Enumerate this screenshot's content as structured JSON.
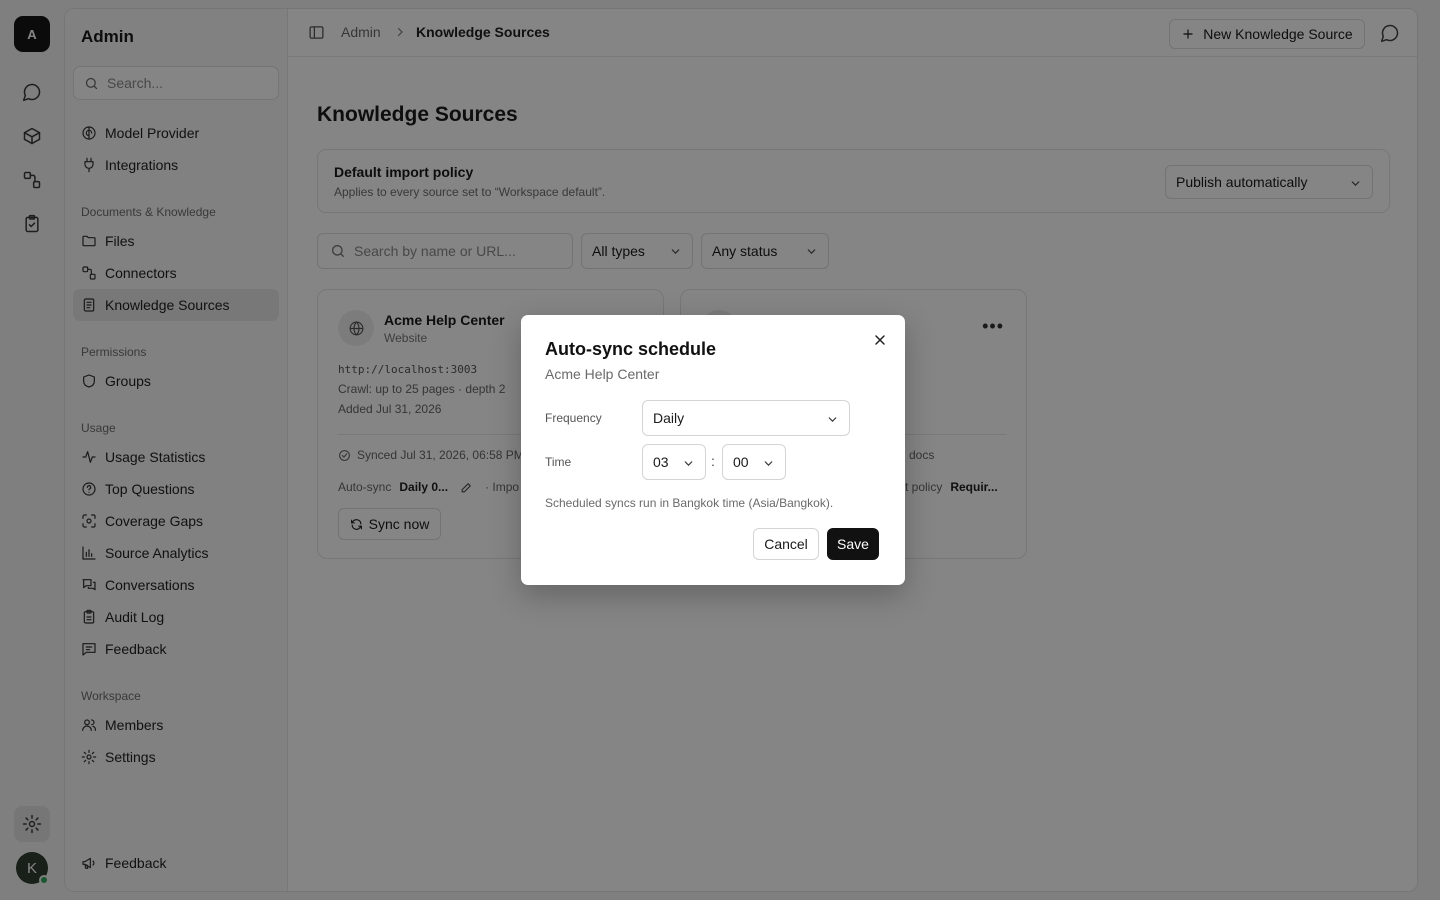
{
  "rail": {
    "logo": "A",
    "avatar": "K",
    "icons": [
      "chat-icon",
      "cube-icon",
      "connectors-icon",
      "clipboard-check-icon",
      "gear-icon"
    ]
  },
  "sidebar": {
    "title": "Admin",
    "search_placeholder": "Search...",
    "items_top": [
      {
        "label": "Model Provider",
        "icon": "brain-icon"
      },
      {
        "label": "Integrations",
        "icon": "plug-icon"
      }
    ],
    "section_docs": "Documents & Knowledge",
    "items_docs": [
      {
        "label": "Files",
        "icon": "folder-icon"
      },
      {
        "label": "Connectors",
        "icon": "connectors-icon"
      },
      {
        "label": "Knowledge Sources",
        "icon": "book-icon",
        "active": true
      }
    ],
    "section_permissions": "Permissions",
    "items_permissions": [
      {
        "label": "Groups",
        "icon": "shield-icon"
      }
    ],
    "section_usage": "Usage",
    "items_usage": [
      {
        "label": "Usage Statistics",
        "icon": "activity-icon"
      },
      {
        "label": "Top Questions",
        "icon": "help-circle-icon"
      },
      {
        "label": "Coverage Gaps",
        "icon": "scan-icon"
      },
      {
        "label": "Source Analytics",
        "icon": "bar-chart-icon"
      },
      {
        "label": "Conversations",
        "icon": "messages-icon"
      },
      {
        "label": "Audit Log",
        "icon": "clipboard-icon"
      },
      {
        "label": "Feedback",
        "icon": "message-square-text-icon"
      }
    ],
    "section_workspace": "Workspace",
    "items_workspace": [
      {
        "label": "Members",
        "icon": "users-icon"
      },
      {
        "label": "Settings",
        "icon": "gear-icon"
      }
    ],
    "footer_feedback": "Feedback"
  },
  "topbar": {
    "crumb_root": "Admin",
    "crumb_current": "Knowledge Sources",
    "new_button": "New Knowledge Source"
  },
  "main": {
    "title": "Knowledge Sources",
    "policy": {
      "title": "Default import policy",
      "subtitle": "Applies to every source set to “Workspace default”.",
      "value": "Publish automatically"
    },
    "filters": {
      "search_placeholder": "Search by name or URL...",
      "type": "All types",
      "status": "Any status"
    },
    "cards": [
      {
        "name": "Acme Help Center",
        "type": "Website",
        "url": "http://localhost:3003",
        "crawl": "Crawl: up to 25 pages · depth 2",
        "added": "Added Jul 31, 2026",
        "synced": "Synced Jul 31, 2026, 06:58 PM",
        "autosync_label": "Auto-sync",
        "autosync_value": "Daily 0...",
        "import_fragment": "· Impo",
        "sync_button": "Sync now"
      },
      {
        "synced_fragment": "docs",
        "policy_fragment": "rt policy",
        "policy_value": "Requir..."
      }
    ]
  },
  "modal": {
    "title": "Auto-sync schedule",
    "subtitle": "Acme Help Center",
    "frequency_label": "Frequency",
    "frequency_value": "Daily",
    "time_label": "Time",
    "hour": "03",
    "minute": "00",
    "colon": ":",
    "note": "Scheduled syncs run in Bangkok time (Asia/Bangkok).",
    "cancel": "Cancel",
    "save": "Save"
  }
}
